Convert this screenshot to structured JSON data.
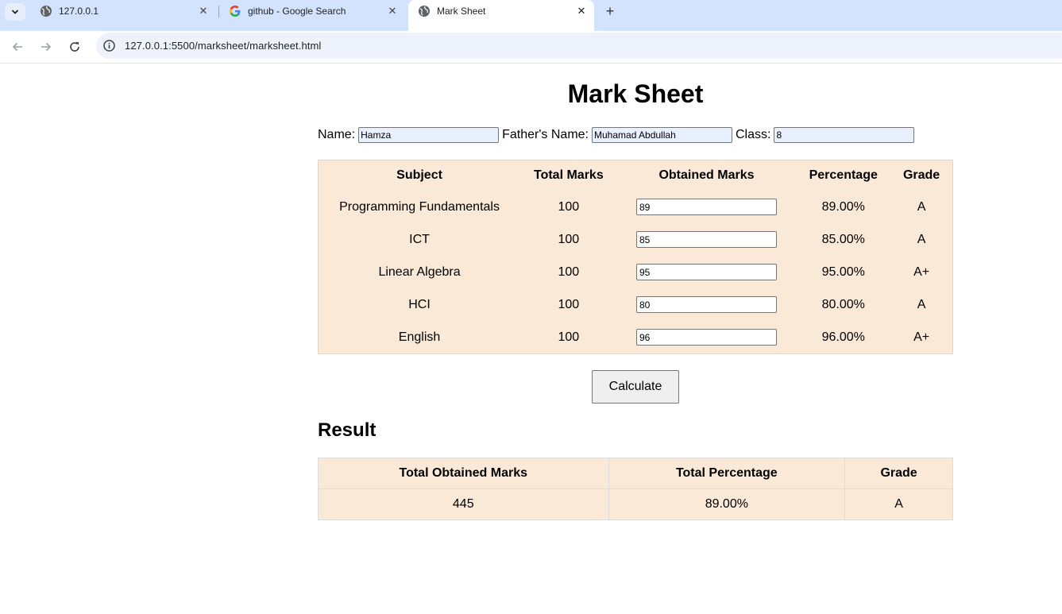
{
  "browser": {
    "tabs": [
      {
        "title": "127.0.0.1",
        "active": false
      },
      {
        "title": "github - Google Search",
        "active": false
      },
      {
        "title": "Mark Sheet",
        "active": true
      }
    ],
    "url": "127.0.0.1:5500/marksheet/marksheet.html"
  },
  "page": {
    "title": "Mark Sheet",
    "student": {
      "name_label": "Name:",
      "name_value": "Hamza",
      "father_label": "Father's Name:",
      "father_value": "Muhamad Abdullah",
      "class_label": "Class:",
      "class_value": "8"
    },
    "marks_table": {
      "headers": [
        "Subject",
        "Total Marks",
        "Obtained Marks",
        "Percentage",
        "Grade"
      ],
      "rows": [
        {
          "subject": "Programming Fundamentals",
          "total": "100",
          "obtained": "89",
          "percentage": "89.00%",
          "grade": "A"
        },
        {
          "subject": "ICT",
          "total": "100",
          "obtained": "85",
          "percentage": "85.00%",
          "grade": "A"
        },
        {
          "subject": "Linear Algebra",
          "total": "100",
          "obtained": "95",
          "percentage": "95.00%",
          "grade": "A+"
        },
        {
          "subject": "HCI",
          "total": "100",
          "obtained": "80",
          "percentage": "80.00%",
          "grade": "A"
        },
        {
          "subject": "English",
          "total": "100",
          "obtained": "96",
          "percentage": "96.00%",
          "grade": "A+"
        }
      ]
    },
    "calculate_label": "Calculate",
    "result": {
      "heading": "Result",
      "headers": [
        "Total Obtained Marks",
        "Total Percentage",
        "Grade"
      ],
      "total_obtained": "445",
      "total_percentage": "89.00%",
      "grade": "A"
    }
  },
  "colors": {
    "table_bg": "#fae9d7",
    "tabstrip_bg": "#d3e3fd",
    "autofill_bg": "#e8f0fe"
  }
}
